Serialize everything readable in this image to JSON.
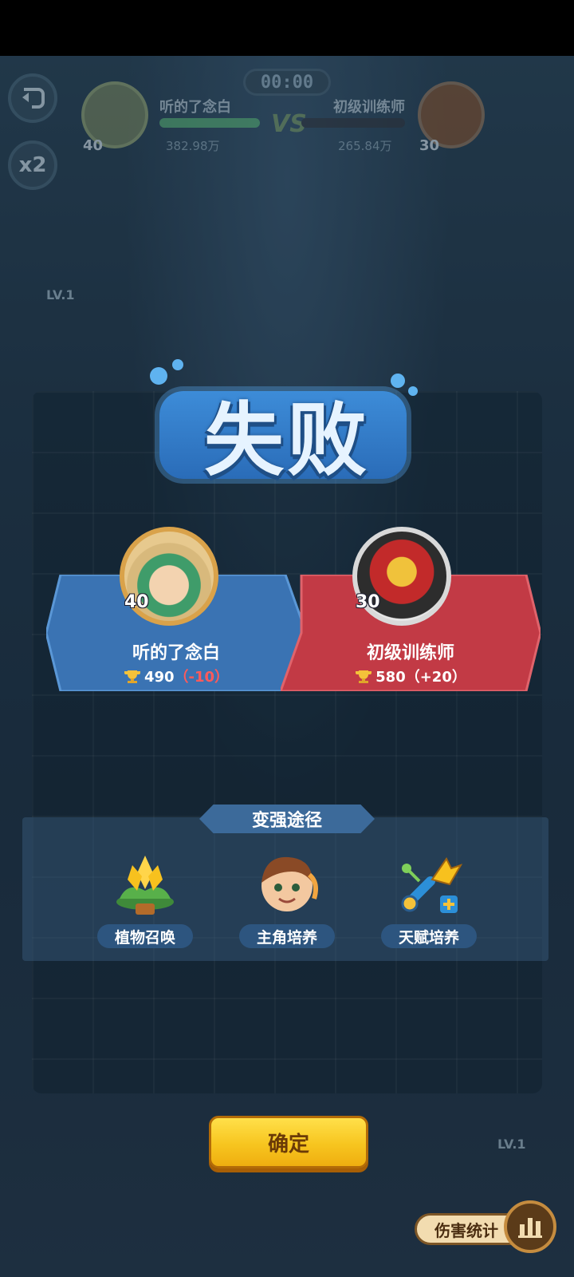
{
  "hud": {
    "timer": "00:00",
    "back_icon": "back-arrow-icon",
    "speed_label": "x2",
    "vs_label": "VS",
    "left_player": {
      "level": "40",
      "name": "听的了念白",
      "power": "382.98万"
    },
    "right_player": {
      "level": "30",
      "name": "初级训练师",
      "power": "265.84万"
    }
  },
  "side_markers": {
    "left_level": "LV.1",
    "right_level": "LV.1"
  },
  "result": {
    "title": "失败",
    "color": "#2a6cb8"
  },
  "players": {
    "left": {
      "level": "40",
      "name": "听的了念白",
      "trophies": "490",
      "delta": "（-10）",
      "panel_color": "#3a73b3"
    },
    "right": {
      "level": "30",
      "name": "初级训练师",
      "trophies": "580",
      "delta": "（+20）",
      "panel_color": "#c23a45"
    }
  },
  "improve": {
    "header": "变强途径",
    "paths": [
      {
        "label": "植物召唤",
        "icon": "plant-summon-icon"
      },
      {
        "label": "主角培养",
        "icon": "hero-portrait-icon"
      },
      {
        "label": "天赋培养",
        "icon": "talent-wrench-icon"
      }
    ]
  },
  "confirm_label": "确定",
  "damage_stats_label": "伤害统计"
}
